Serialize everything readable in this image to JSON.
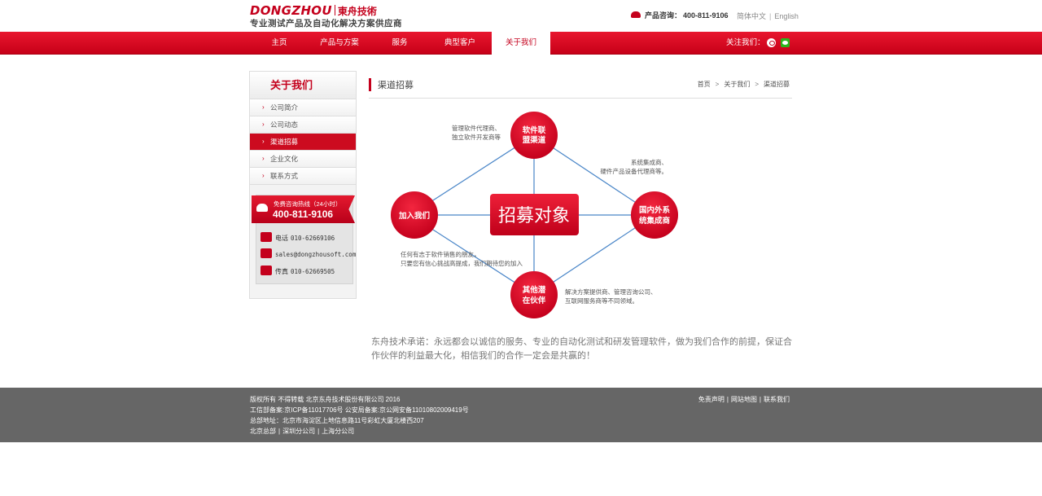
{
  "header": {
    "logo_en": "DONGZHOU",
    "logo_cn": "東舟技術",
    "slogan": "专业测试产品及自动化解决方案供应商",
    "hotline_label": "产品咨询：",
    "hotline_number": "400-811-9106",
    "lang_cn": "简体中文",
    "lang_en": "English"
  },
  "nav": {
    "items": [
      "主页",
      "产品与方案",
      "服务",
      "典型客户",
      "关于我们"
    ],
    "active": "关于我们",
    "follow_label": "关注我们："
  },
  "sidebar": {
    "title": "关于我们",
    "items": [
      "公司简介",
      "公司动态",
      "渠道招募",
      "企业文化",
      "联系方式"
    ],
    "active": "渠道招募",
    "hotline_caption": "免费咨询热线（24小时）",
    "hotline_number": "400-811-9106",
    "contacts": [
      {
        "label": "电话",
        "value": "010-62669106"
      },
      {
        "label": "",
        "value": "sales@dongzhousoft.com"
      },
      {
        "label": "传真",
        "value": "010-62669505"
      }
    ]
  },
  "main": {
    "title": "渠道招募",
    "breadcrumb": [
      "首页",
      "关于我们",
      "渠道招募"
    ],
    "breadcrumb_sep": ">"
  },
  "diagram": {
    "center": "招募对象",
    "nodes": {
      "top": [
        "软件联",
        "盟渠道"
      ],
      "left": [
        "加入我们"
      ],
      "right": [
        "国内外系",
        "统集成商"
      ],
      "bottom": [
        "其他潜",
        "在伙伴"
      ]
    },
    "notes": {
      "top": [
        "管理软件代理商、",
        "独立软件开发商等"
      ],
      "right": [
        "系统集成商、",
        "硬件产品设备代理商等。"
      ],
      "left": [
        "任何有志于软件销售的朋友，",
        "只要您有信心挑战高提成，我们期待您的加入"
      ],
      "bottom": [
        "解决方案提供商、管理咨询公司、",
        "互联网服务商等不同领域。"
      ]
    }
  },
  "promise": "东舟技术承诺：永远都会以诚信的服务、专业的自动化测试和研发管理软件，做为我们合作的前提，保证合作伙伴的利益最大化，相信我们的合作一定会是共赢的！",
  "footer": {
    "lines": [
      "版权所有 不得转载 北京东舟技术股份有限公司 2016",
      "工信部备案:京ICP备11017706号 公安局备案:京公网安备11010802009419号",
      "总部地址：北京市海淀区上地信息路11号彩虹大厦北楼西207"
    ],
    "offices": [
      "北京总部",
      "深圳分公司",
      "上海分公司"
    ],
    "links": [
      "免责声明",
      "网站地图",
      "联系我们"
    ]
  },
  "colors": {
    "brand_red": "#c4001c",
    "footer_gray": "#666666",
    "line_blue": "#4a86c8"
  }
}
